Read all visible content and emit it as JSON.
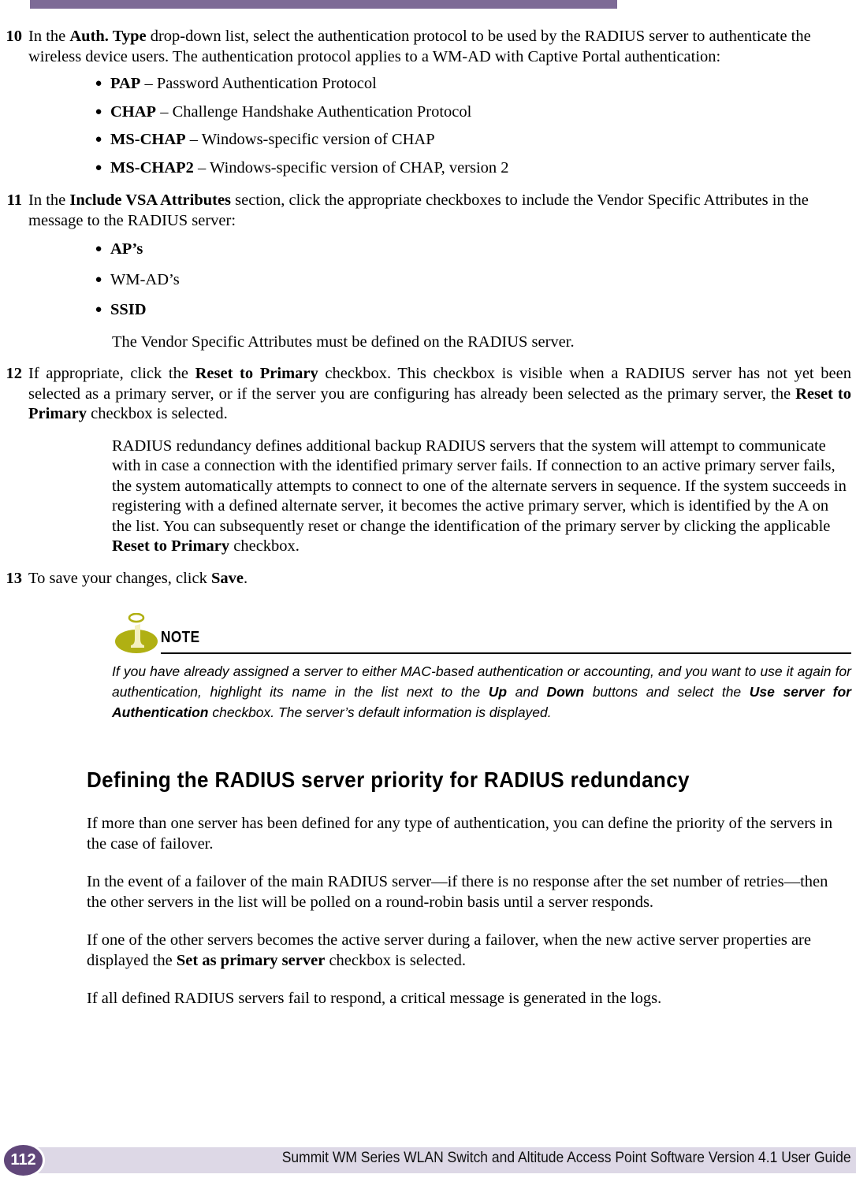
{
  "page": {
    "number": "112",
    "footer_title": "Summit WM Series WLAN Switch and Altitude Access Point Software Version 4.1 User Guide",
    "accent_purple": "#7d6a96",
    "footer_bar_color": "#ddd8e6",
    "badge_color": "#61477a",
    "note_icon_color": "#b0b013"
  },
  "steps": [
    {
      "num": "10",
      "parts": [
        {
          "text": "In the ",
          "bold": false
        },
        {
          "text": "Auth. Type",
          "bold": true
        },
        {
          "text": " drop-down list, select the authentication protocol to be used by the RADIUS server to authenticate the wireless device users. The authentication protocol applies to a WM-AD with Captive Portal authentication:",
          "bold": false
        }
      ]
    },
    {
      "num": "11",
      "parts": [
        {
          "text": "In the ",
          "bold": false
        },
        {
          "text": "Include VSA Attributes",
          "bold": true
        },
        {
          "text": " section, click the appropriate checkboxes to include the Vendor Specific Attributes in the message to the RADIUS server:",
          "bold": false
        }
      ]
    },
    {
      "num": "12",
      "parts": [
        {
          "text": "If appropriate, click the ",
          "bold": false
        },
        {
          "text": "Reset to Primary",
          "bold": true
        },
        {
          "text": " checkbox. This checkbox is visible when a RADIUS server has not yet been selected as a primary server, or if the server you are configuring has already been selected as the primary server, the ",
          "bold": false
        },
        {
          "text": "Reset to Primary",
          "bold": true
        },
        {
          "text": " checkbox is selected.",
          "bold": false
        }
      ]
    },
    {
      "num": "13",
      "parts": [
        {
          "text": "To save your changes, click ",
          "bold": false
        },
        {
          "text": "Save",
          "bold": true
        },
        {
          "text": ".",
          "bold": false
        }
      ]
    }
  ],
  "auth_types": [
    [
      {
        "text": "PAP",
        "bold": true
      },
      {
        "text": " – Password Authentication Protocol",
        "bold": false
      }
    ],
    [
      {
        "text": "CHAP",
        "bold": true
      },
      {
        "text": " – Challenge Handshake Authentication Protocol",
        "bold": false
      }
    ],
    [
      {
        "text": "MS-CHAP",
        "bold": true
      },
      {
        "text": " – Windows-specific version of CHAP",
        "bold": false
      }
    ],
    [
      {
        "text": "MS-CHAP2",
        "bold": true
      },
      {
        "text": " – Windows-specific version of CHAP, version 2",
        "bold": false
      }
    ]
  ],
  "vsa_attributes": [
    [
      {
        "text": "AP’s",
        "bold": true
      }
    ],
    [
      {
        "text": "WM-AD’s",
        "bold": false
      }
    ],
    [
      {
        "text": "SSID",
        "bold": true
      }
    ]
  ],
  "vsa_note": [
    {
      "text": "The Vendor Specific Attributes must be defined on the RADIUS server.",
      "bold": false
    }
  ],
  "redundancy_para": [
    {
      "text": "RADIUS redundancy defines additional backup RADIUS servers that the system will attempt to communicate with in case a connection with the identified primary server fails. If connection to an active primary server fails, the system automatically attempts to connect to one of the alternate servers in sequence. If the system succeeds in registering with a defined alternate server, it becomes the active primary server, which is identified by the A on the list. You can subsequently reset or change the identification of the primary server by clicking the applicable ",
      "bold": false
    },
    {
      "text": "Reset to Primary",
      "bold": true
    },
    {
      "text": " checkbox.",
      "bold": false
    }
  ],
  "note": {
    "label": "NOTE",
    "parts": [
      {
        "text": "If you have already assigned a server to either MAC-based authentication or accounting, and you want to use it again for authentication, highlight its name in the list next to the ",
        "bold": false
      },
      {
        "text": "Up",
        "bold": true
      },
      {
        "text": " and ",
        "bold": false
      },
      {
        "text": "Down",
        "bold": true
      },
      {
        "text": " buttons and select the ",
        "bold": false
      },
      {
        "text": "Use server for Authentication",
        "bold": true
      },
      {
        "text": " checkbox. The server’s default information is displayed.",
        "bold": false
      }
    ]
  },
  "section": {
    "heading": "Defining the RADIUS server priority for RADIUS redundancy",
    "paragraphs": [
      [
        {
          "text": "If more than one server has been defined for any type of authentication, you can define the priority of the servers in the case of failover.",
          "bold": false
        }
      ],
      [
        {
          "text": "In the event of a failover of the main RADIUS server—if there is no response after the set number of retries—then the other servers in the list will be polled on a round-robin basis until a server responds.",
          "bold": false
        }
      ],
      [
        {
          "text": "If one of the other servers becomes the active server during a failover, when the new active server properties are displayed the ",
          "bold": false
        },
        {
          "text": "Set as primary server",
          "bold": true
        },
        {
          "text": " checkbox is selected.",
          "bold": false
        }
      ],
      [
        {
          "text": "If all defined RADIUS servers fail to respond, a critical message is generated in the logs.",
          "bold": false
        }
      ]
    ]
  },
  "bullet_glyph": "●"
}
